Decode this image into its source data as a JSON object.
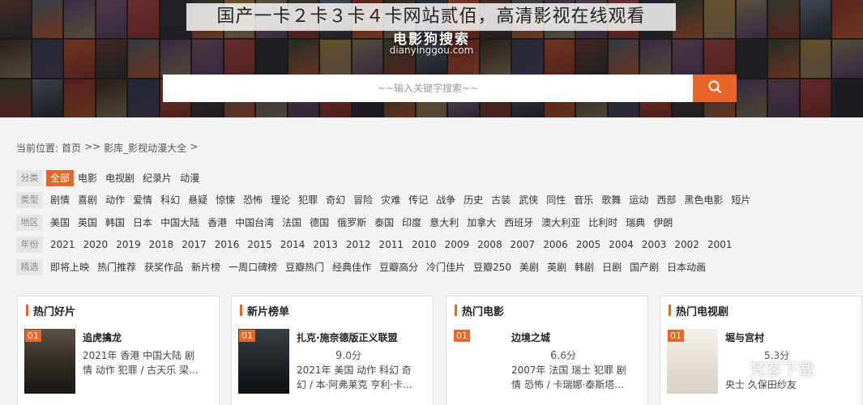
{
  "site_title": "国产一卡２卡３卡４卡网站贰佰，高清影视在线观看",
  "logo": {
    "cn": "电影狗搜索",
    "en": "dianyinggou.com"
  },
  "search": {
    "placeholder": "~~输入关键字搜索~~",
    "icon": "search-icon"
  },
  "breadcrumb": [
    "当前位置:",
    "首页",
    ">>",
    "影库_影视动漫大全",
    ">"
  ],
  "filters": [
    {
      "label": "分类",
      "options": [
        "全部",
        "电影",
        "电视剧",
        "纪录片",
        "动漫"
      ],
      "active": 0
    },
    {
      "label": "类型",
      "options": [
        "剧情",
        "喜剧",
        "动作",
        "爱情",
        "科幻",
        "悬疑",
        "惊悚",
        "恐怖",
        "理论",
        "犯罪",
        "奇幻",
        "冒险",
        "灾难",
        "传记",
        "战争",
        "历史",
        "古装",
        "武侠",
        "同性",
        "音乐",
        "歌舞",
        "运动",
        "西部",
        "黑色电影",
        "短片"
      ],
      "active": -1
    },
    {
      "label": "地区",
      "options": [
        "美国",
        "英国",
        "韩国",
        "日本",
        "中国大陆",
        "香港",
        "中国台湾",
        "法国",
        "德国",
        "俄罗斯",
        "泰国",
        "印度",
        "意大利",
        "加拿大",
        "西班牙",
        "澳大利亚",
        "比利时",
        "瑞典",
        "伊朗"
      ],
      "active": -1
    },
    {
      "label": "年份",
      "options": [
        "2021",
        "2020",
        "2019",
        "2018",
        "2017",
        "2016",
        "2015",
        "2014",
        "2013",
        "2012",
        "2011",
        "2010",
        "2009",
        "2008",
        "2007",
        "2006",
        "2005",
        "2004",
        "2003",
        "2002",
        "2001"
      ],
      "active": -1
    },
    {
      "label": "精选",
      "options": [
        "即将上映",
        "热门推荐",
        "获奖作品",
        "新片榜",
        "一周口碑榜",
        "豆瓣热门",
        "经典佳作",
        "豆瓣高分",
        "冷门佳片",
        "豆瓣250",
        "美剧",
        "英剧",
        "韩剧",
        "日剧",
        "国产剧",
        "日本动画"
      ],
      "active": -1
    }
  ],
  "cards": [
    {
      "title": "热门好片",
      "rank": "01",
      "name": "追虎擒龙",
      "score_big": "",
      "score_small": "",
      "line1": "2021年 香港 中国大陆 剧",
      "line2": "情 动作 犯罪 / 古天乐 梁..."
    },
    {
      "title": "新片榜单",
      "rank": "01",
      "name": "扎克·施奈德版正义联盟",
      "score_big": "9.",
      "score_small": "0分",
      "line1": "2021年 美国 动作 科幻 奇",
      "line2": "幻 / 本·阿弗莱克 亨利·卡..."
    },
    {
      "title": "热门电影",
      "rank": "01",
      "name": "边境之城",
      "score_big": "6.",
      "score_small": "6分",
      "line1": "2007年 法国 瑞士 犯罪 剧",
      "line2": "情 恐怖 / 卡瑞娜·泰斯塔..."
    },
    {
      "title": "热门电视剧",
      "rank": "01",
      "name": "堀与宫村",
      "score_big": "",
      "score_small": "5.3分",
      "line1": "",
      "line2": "央士 久保田纱友"
    }
  ],
  "watermark": "梵客下载",
  "colors": {
    "accent": "#e8662a"
  }
}
